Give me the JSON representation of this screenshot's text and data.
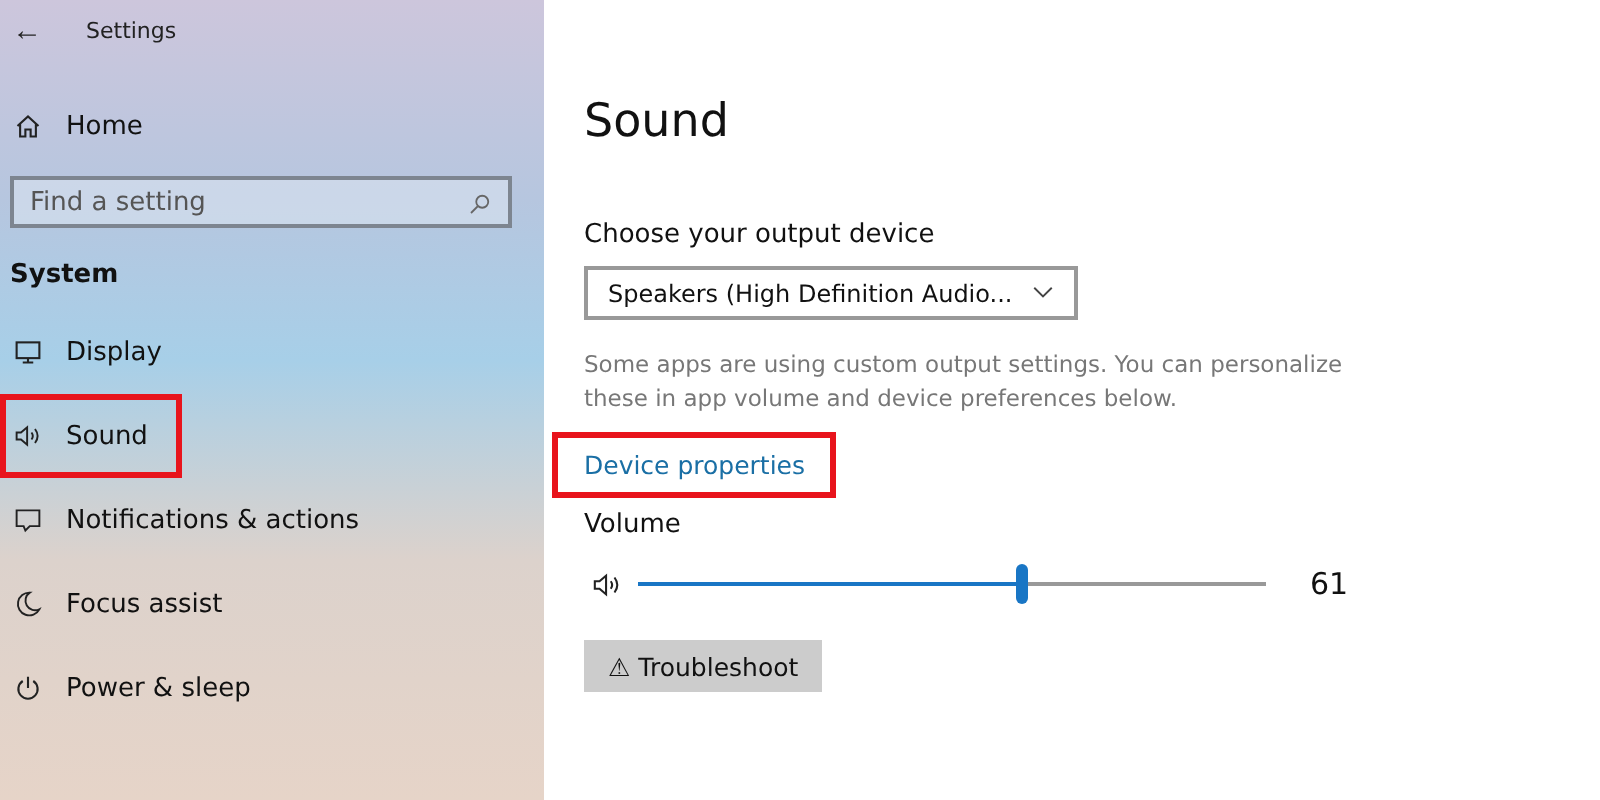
{
  "window": {
    "title": "Settings",
    "back_icon": "←"
  },
  "sidebar": {
    "home": "Home",
    "search": {
      "placeholder": "Find a setting"
    },
    "section": "System",
    "items": [
      {
        "kind": "display",
        "label": "Display",
        "highlighted": false
      },
      {
        "kind": "sound",
        "label": "Sound",
        "highlighted": true
      },
      {
        "kind": "notifications",
        "label": "Notifications & actions",
        "highlighted": false
      },
      {
        "kind": "focus",
        "label": "Focus assist",
        "highlighted": false
      },
      {
        "kind": "power",
        "label": "Power & sleep",
        "highlighted": false
      }
    ]
  },
  "main": {
    "title": "Sound",
    "output_label": "Choose your output device",
    "output_device": "Speakers (High Definition Audio...",
    "description": "Some apps are using custom output settings. You can personalize these in app volume and device preferences below.",
    "link": {
      "label": "Device properties",
      "highlighted": true
    },
    "volume": {
      "label": "Volume",
      "level": 0.61,
      "reading": "61"
    },
    "troubleshoot": {
      "icon": "⚠",
      "label": "Troubleshoot"
    }
  }
}
